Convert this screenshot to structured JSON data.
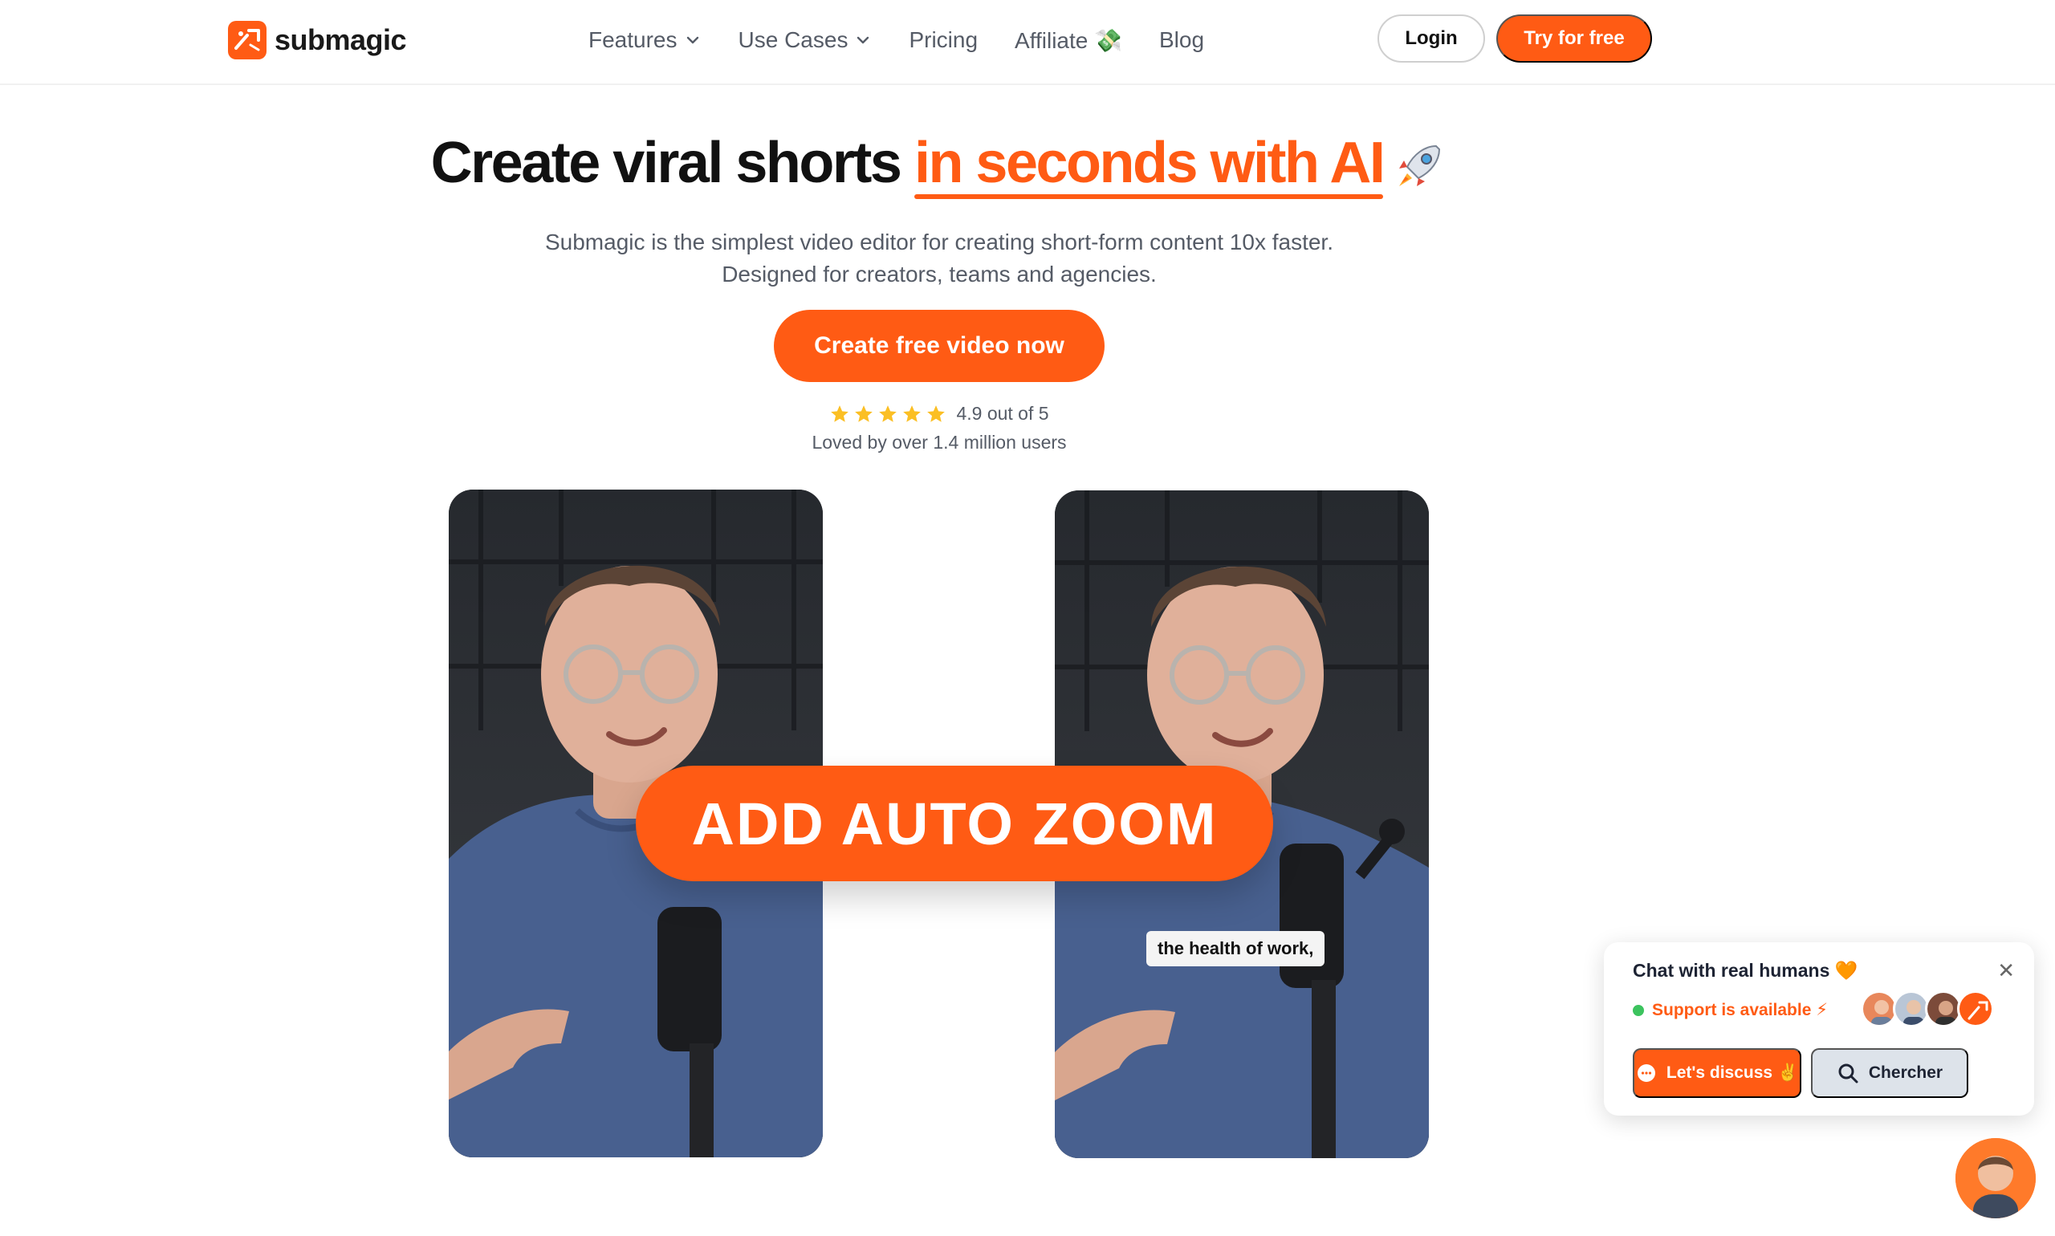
{
  "nav": {
    "logo_text": "submagic",
    "links": [
      {
        "label": "Features",
        "has_dropdown": true
      },
      {
        "label": "Use Cases",
        "has_dropdown": true
      },
      {
        "label": "Pricing",
        "has_dropdown": false
      },
      {
        "label": "Affiliate 💸",
        "has_dropdown": false
      },
      {
        "label": "Blog",
        "has_dropdown": false
      }
    ],
    "login_label": "Login",
    "try_label": "Try for free"
  },
  "hero": {
    "title_main": "Create viral shorts ",
    "title_accent": "in seconds with AI",
    "subtitle_line1": "Submagic is the simplest video editor for creating short-form content 10x faster.",
    "subtitle_line2": "Designed for creators, teams and agencies.",
    "cta_label": "Create free video now",
    "rating_text": "4.9 out of 5",
    "rating_stars": 5,
    "loved_text": "Loved by over 1.4 million users"
  },
  "demo": {
    "banner_text": "ADD AUTO ZOOM",
    "caption_text": "the health of work,"
  },
  "chat_widget": {
    "title": "Chat with real humans 🧡",
    "status": "Support is available ⚡",
    "discuss_label": "Let's discuss ✌️",
    "search_label": "Chercher"
  },
  "colors": {
    "brand": "#ff5b14",
    "text_muted": "#555b66",
    "star": "#fbbf24",
    "status_green": "#3cc35e"
  }
}
